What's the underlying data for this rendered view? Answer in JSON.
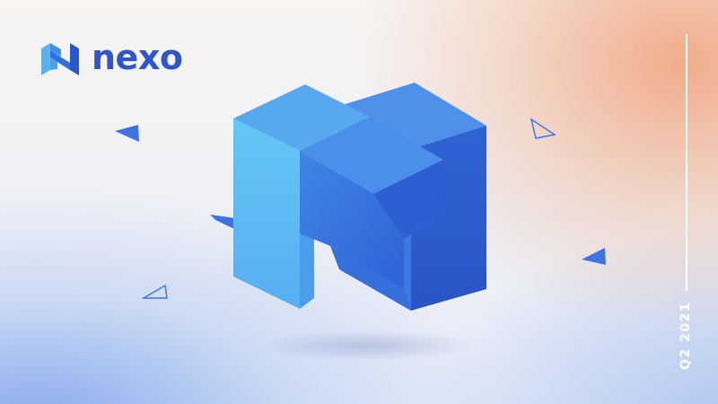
{
  "brand": {
    "name": "nexo",
    "color": "#2f55c9",
    "logo_icon": "nexo-n-icon"
  },
  "period_label": "Q2 2021",
  "colors": {
    "accent_blue": "#2f6fe0",
    "light_blue": "#59b8f2",
    "warm_glow": "#f0a078",
    "text_white": "#ffffff"
  }
}
